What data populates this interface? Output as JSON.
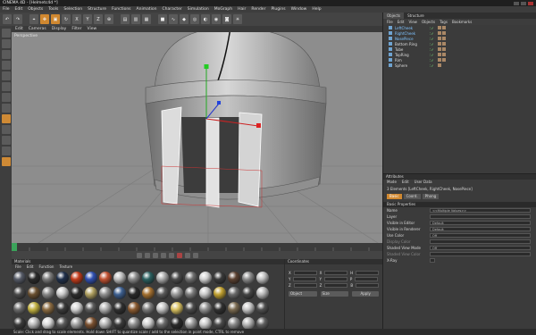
{
  "window": {
    "title": "CINEMA 4D - [Helmetc4d *]"
  },
  "menu": [
    "File",
    "Edit",
    "Objects",
    "Tools",
    "Selection",
    "Structure",
    "Functions",
    "Animation",
    "Character",
    "Simulation",
    "MoGraph",
    "Hair",
    "Render",
    "Plugins",
    "Window",
    "Help"
  ],
  "viewport": {
    "menu": [
      "Edit",
      "Cameras",
      "Display",
      "Filter",
      "View"
    ],
    "label": "Perspective"
  },
  "object_manager": {
    "tabs": [
      "Objects",
      "Structure"
    ],
    "menu": [
      "File",
      "Edit",
      "View",
      "Objects",
      "Tags",
      "Bookmarks"
    ],
    "objects": [
      {
        "name": "LeftCheek",
        "selected": true
      },
      {
        "name": "RightCheek",
        "selected": true
      },
      {
        "name": "NosePiece",
        "selected": true
      },
      {
        "name": "Bottom Ring",
        "selected": false
      },
      {
        "name": "Tube",
        "selected": false
      },
      {
        "name": "TopRing",
        "selected": false
      },
      {
        "name": "Rim",
        "selected": false
      },
      {
        "name": "Sphere",
        "selected": false
      }
    ]
  },
  "attributes": {
    "title": "Attributes",
    "menu": [
      "Mode",
      "Edit",
      "User Data"
    ],
    "header": "3 Elements [LeftCheek, RightCheek, NosePiece]",
    "tabs": [
      "Basic",
      "Coord.",
      "Phong"
    ],
    "section": "Basic Properties",
    "props": [
      {
        "label": "Name",
        "value": "<<Multiple Values>>"
      },
      {
        "label": "Layer",
        "value": ""
      },
      {
        "label": "Visible in Editor",
        "value": "Default"
      },
      {
        "label": "Visible in Renderer",
        "value": "Default"
      },
      {
        "label": "Use Color",
        "value": "Off"
      },
      {
        "label": "Display Color",
        "value": ""
      },
      {
        "label": "Shaded View Mode",
        "value": "Off"
      },
      {
        "label": "Shaded View Color",
        "value": ""
      },
      {
        "label": "X-Ray",
        "value": ""
      }
    ]
  },
  "materials": {
    "title": "Materials",
    "menu": [
      "File",
      "Edit",
      "Function",
      "Texture"
    ],
    "colors": [
      "#555a66",
      "#2a2a2a",
      "#7a7a7a",
      "#1f2f4a",
      "#c23a1a",
      "#2f4fb0",
      "#c05030",
      "#bdbdbd",
      "#8a8a8a",
      "#2a5f5f",
      "#aaaaaa",
      "#4a4a4a",
      "#6e6e6e",
      "#d0d0d0",
      "#3a3a3a",
      "#5a4030",
      "#8a8a8a",
      "#bfbfbf",
      "#4a4a4a",
      "#6a5030",
      "#888888",
      "#c9c9c9",
      "#2b2b2b",
      "#b0a060",
      "#8f8f8f",
      "#3d5f8f",
      "#2a2a2a",
      "#a47030",
      "#5a5a5a",
      "#9a9a9a",
      "#7a7a7a",
      "#c8c8c8",
      "#c0a030",
      "#6a6a6a",
      "#444444",
      "#b8b8b8",
      "#6a6a6a",
      "#c0b040",
      "#8a6a40",
      "#3a3a3a",
      "#d4d4d4",
      "#5a5a5a",
      "#b0b0b0",
      "#2f2f2f",
      "#8a5a30",
      "#7a7a7a",
      "#c4c4c4",
      "#d8c060",
      "#4a4a4a",
      "#909090",
      "#303030",
      "#7a6a50",
      "#c6c6c6",
      "#4f4f4f",
      "#3a3a3a",
      "#b8b8b8",
      "#d9d9d9",
      "#5a5a5a",
      "#a0a0a0",
      "#7a5030",
      "#b5b5b5",
      "#3a3a3a",
      "#8f8f8f",
      "#d0d0d0",
      "#6a6a6a",
      "#2a2a2a",
      "#9c9c9c",
      "#c9c9c9",
      "#4a4a4a",
      "#8a8a8a",
      "#b5b5b5",
      "#5f5f5f"
    ]
  },
  "coordinates": {
    "title": "Coordinates",
    "rows": [
      {
        "a": "X",
        "b": "X",
        "c": "H"
      },
      {
        "a": "Y",
        "b": "Y",
        "c": "P"
      },
      {
        "a": "Z",
        "b": "Z",
        "c": "B"
      }
    ],
    "object_btn": "Object",
    "size_btn": "Size",
    "apply_btn": "Apply"
  },
  "status": "Scale: Click and drag to scale elements. Hold down SHIFT to quantize scale / add to the selection in point mode, CTRL to remove"
}
